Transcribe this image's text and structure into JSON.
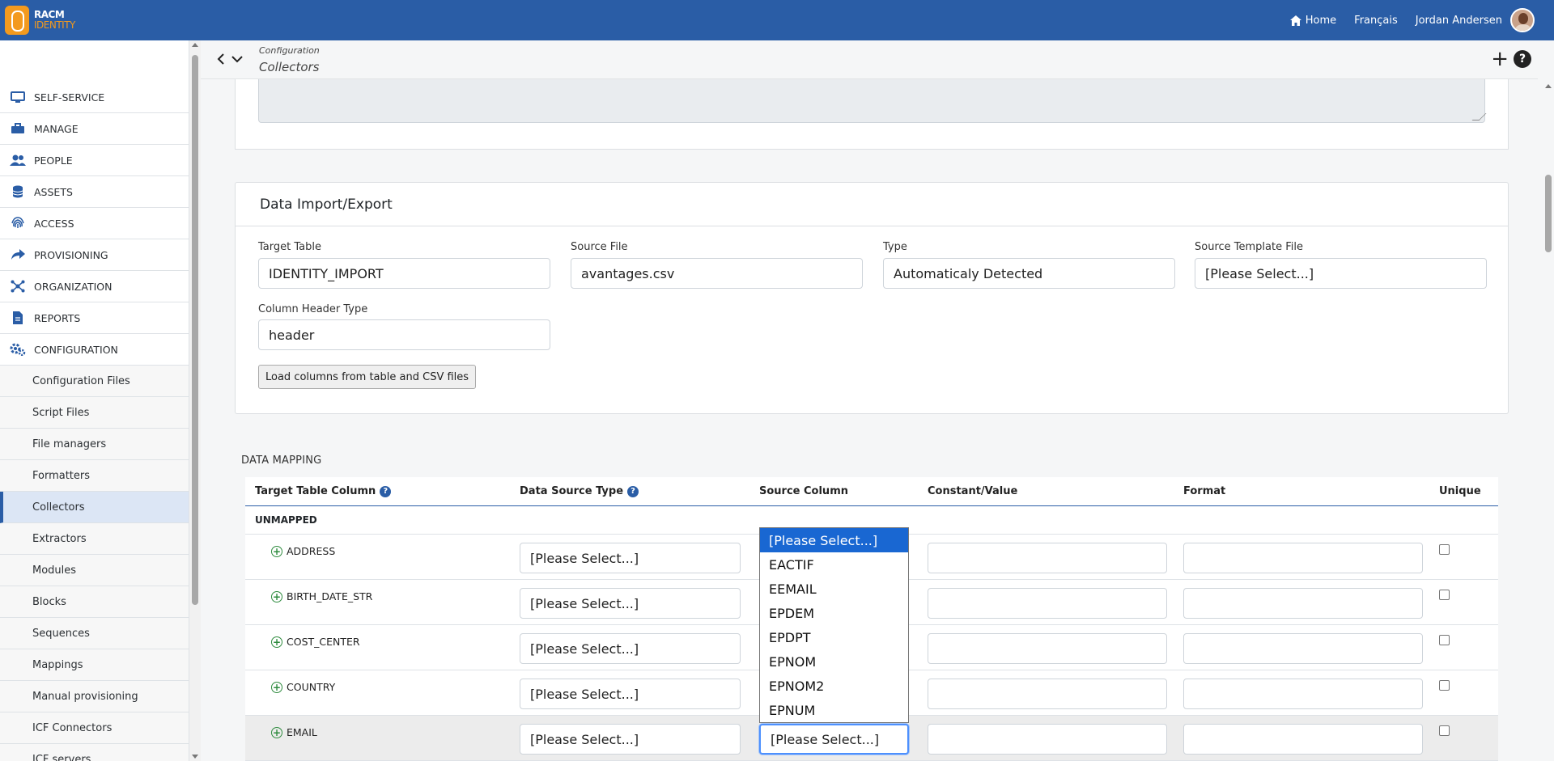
{
  "app": {
    "logo_line1": "RACM",
    "logo_line2": "IDENTITY",
    "home_label": "Home",
    "language_label": "Français",
    "user_name": "Jordan Andersen"
  },
  "sidebar": {
    "items": [
      {
        "label": "SELF-SERVICE",
        "icon": "monitor-icon"
      },
      {
        "label": "MANAGE",
        "icon": "toolbox-icon"
      },
      {
        "label": "PEOPLE",
        "icon": "users-icon"
      },
      {
        "label": "ASSETS",
        "icon": "database-icon"
      },
      {
        "label": "ACCESS",
        "icon": "fingerprint-icon"
      },
      {
        "label": "PROVISIONING",
        "icon": "share-arrow-icon"
      },
      {
        "label": "ORGANIZATION",
        "icon": "network-icon"
      },
      {
        "label": "REPORTS",
        "icon": "file-icon"
      },
      {
        "label": "CONFIGURATION",
        "icon": "gears-icon"
      }
    ],
    "subitems": [
      {
        "label": "Configuration Files"
      },
      {
        "label": "Script Files"
      },
      {
        "label": "File managers"
      },
      {
        "label": "Formatters"
      },
      {
        "label": "Collectors",
        "active": true
      },
      {
        "label": "Extractors"
      },
      {
        "label": "Modules"
      },
      {
        "label": "Blocks"
      },
      {
        "label": "Sequences"
      },
      {
        "label": "Mappings"
      },
      {
        "label": "Manual provisioning"
      },
      {
        "label": "ICF Connectors"
      },
      {
        "label": "ICF servers"
      }
    ]
  },
  "header": {
    "breadcrumb_parent": "Configuration",
    "page_title": "Collectors",
    "add_label": "+",
    "help_label": "?"
  },
  "import_card": {
    "title": "Data Import/Export",
    "target_table_label": "Target Table",
    "target_table_value": "IDENTITY_IMPORT",
    "source_file_label": "Source File",
    "source_file_value": "avantages.csv",
    "type_label": "Type",
    "type_value": "Automaticaly Detected",
    "source_template_label": "Source Template File",
    "source_template_value": "[Please Select...]",
    "column_header_label": "Column Header Type",
    "column_header_value": "header",
    "load_button": "Load columns from table and CSV files"
  },
  "mapping": {
    "title": "DATA MAPPING",
    "columns": {
      "target": "Target Table Column",
      "ds_type": "Data Source Type",
      "source_col": "Source Column",
      "constant": "Constant/Value",
      "format": "Format",
      "unique": "Unique"
    },
    "group_label": "UNMAPPED",
    "select_placeholder": "[Please Select...]",
    "rows": [
      {
        "name": "ADDRESS"
      },
      {
        "name": "BIRTH_DATE_STR"
      },
      {
        "name": "COST_CENTER"
      },
      {
        "name": "COUNTRY"
      },
      {
        "name": "EMAIL"
      }
    ],
    "dropdown_options": [
      "[Please Select...]",
      "EACTIF",
      "EEMAIL",
      "EPDEM",
      "EPDPT",
      "EPNOM",
      "EPNOM2",
      "EPNUM"
    ]
  }
}
